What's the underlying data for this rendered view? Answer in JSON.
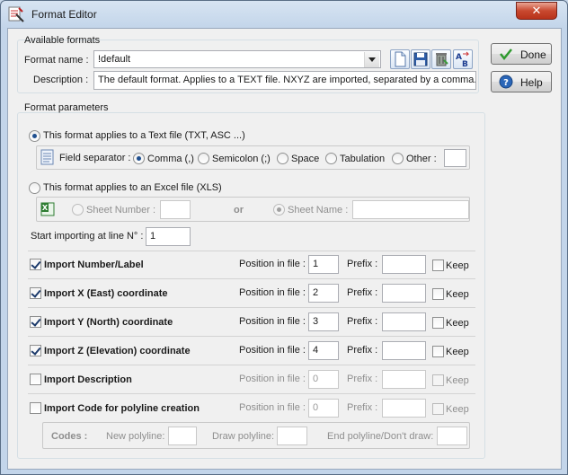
{
  "window": {
    "title": "Format Editor",
    "close_glyph": "✕"
  },
  "available": {
    "group_title": "Available formats",
    "format_name_label": "Format name :",
    "format_name_value": "!default",
    "description_label": "Description :",
    "description_value": "The default format. Applies to a TEXT file. NXYZ are imported, separated by a comma.",
    "tools": [
      "new-file-icon",
      "save-icon",
      "delete-icon",
      "rename-icon"
    ]
  },
  "buttons": {
    "done": "Done",
    "help": "Help"
  },
  "params": {
    "group_title": "Format parameters",
    "text_option": "This format applies to a Text file (TXT, ASC ...)",
    "field_separator_label": "Field separator :",
    "separators": [
      "Comma (,)",
      "Semicolon (;)",
      "Space",
      "Tabulation",
      "Other :"
    ],
    "other_value": "",
    "excel_option": "This format applies to an Excel file (XLS)",
    "sheet_number_label": "Sheet Number :",
    "sheet_number_value": "",
    "or_label": "or",
    "sheet_name_label": "Sheet Name :",
    "sheet_name_value": "",
    "start_line_label": "Start importing at line N° :",
    "start_line_value": "1"
  },
  "imports": [
    {
      "label": "Import Number/Label",
      "checked": true,
      "position": "1",
      "prefix": "",
      "keep": false
    },
    {
      "label": "Import X (East) coordinate",
      "checked": true,
      "position": "2",
      "prefix": "",
      "keep": false
    },
    {
      "label": "Import Y (North) coordinate",
      "checked": true,
      "position": "3",
      "prefix": "",
      "keep": false
    },
    {
      "label": "Import Z (Elevation) coordinate",
      "checked": true,
      "position": "4",
      "prefix": "",
      "keep": false
    },
    {
      "label": "Import Description",
      "checked": false,
      "position": "0",
      "prefix": "",
      "keep": false
    },
    {
      "label": "Import Code for polyline creation",
      "checked": false,
      "position": "0",
      "prefix": "",
      "keep": false
    }
  ],
  "labels": {
    "position": "Position in file :",
    "prefix": "Prefix :",
    "keep": "Keep"
  },
  "codes": {
    "label": "Codes :",
    "new_polyline": "New polyline:",
    "draw_polyline": "Draw polyline:",
    "end_polyline": "End polyline/Don't draw:"
  },
  "colors": {
    "accent": "#1f4f8f",
    "done_check": "#2f9a2f",
    "help": "#2a66b8",
    "close": "#c9492f"
  }
}
